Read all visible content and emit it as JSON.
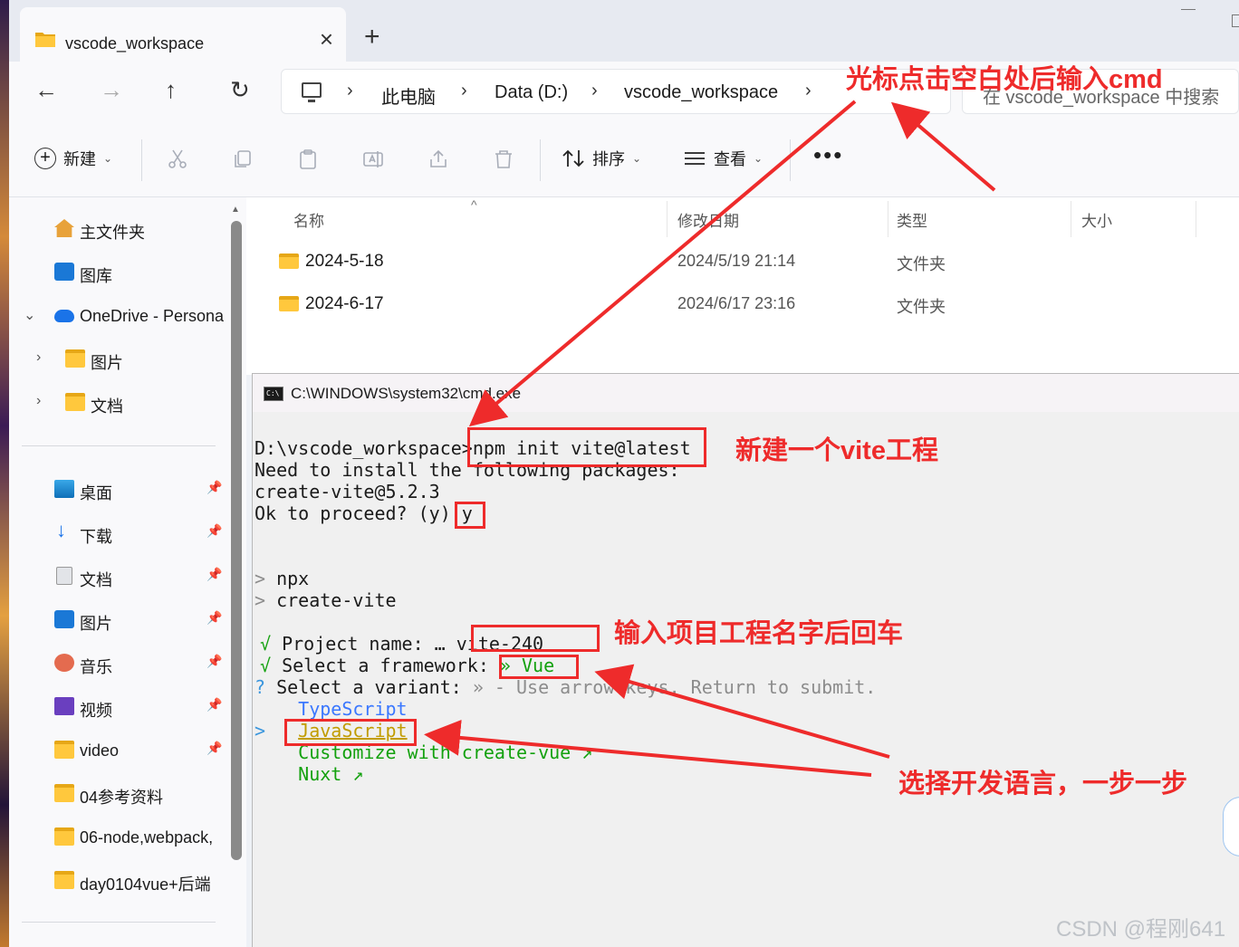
{
  "window": {
    "tab_title": "vscode_workspace",
    "close_glyph": "×",
    "new_tab_glyph": "+"
  },
  "nav": {
    "back": "←",
    "forward": "→",
    "up": "↑",
    "refresh": "↻"
  },
  "address": {
    "breadcrumbs": [
      "此电脑",
      "Data (D:)",
      "vscode_workspace"
    ],
    "separator": "›",
    "search_placeholder": "在 vscode_workspace 中搜索"
  },
  "commandbar": {
    "new_label": "新建",
    "sort_label": "排序",
    "view_label": "查看",
    "more_label": "•••",
    "caret": "⌄",
    "icons": [
      "cut-icon",
      "copy-icon",
      "paste-icon",
      "rename-icon",
      "share-icon",
      "delete-icon"
    ]
  },
  "sidebar": {
    "top_items": [
      {
        "label": "主文件夹",
        "icon": "home-icon"
      },
      {
        "label": "图库",
        "icon": "gallery-icon"
      },
      {
        "label": "OneDrive - Personal",
        "icon": "cloud-icon"
      },
      {
        "label": "图片",
        "icon": "folder-icon"
      },
      {
        "label": "文档",
        "icon": "folder-icon"
      }
    ],
    "pinned_items": [
      {
        "label": "桌面",
        "icon": "desktop-icon"
      },
      {
        "label": "下载",
        "icon": "download-icon"
      },
      {
        "label": "文档",
        "icon": "documents-icon"
      },
      {
        "label": "图片",
        "icon": "pictures-icon"
      },
      {
        "label": "音乐",
        "icon": "music-icon"
      },
      {
        "label": "视频",
        "icon": "video-icon"
      },
      {
        "label": "video",
        "icon": "folder-icon"
      },
      {
        "label": "04参考资料",
        "icon": "folder-icon"
      },
      {
        "label": "06-node,webpack,",
        "icon": "folder-icon"
      },
      {
        "label": "day0104vue+后端",
        "icon": "folder-icon"
      }
    ],
    "expand_glyph": "⌄",
    "collapse_glyph": "›",
    "pin_glyph": "📌"
  },
  "file_list": {
    "columns": [
      "名称",
      "修改日期",
      "类型",
      "大小"
    ],
    "sort_glyph": "^",
    "rows": [
      {
        "name": "2024-5-18",
        "date": "2024/5/19 21:14",
        "type": "文件夹"
      },
      {
        "name": "2024-6-17",
        "date": "2024/6/17 23:16",
        "type": "文件夹"
      }
    ]
  },
  "cmd": {
    "title": "C:\\WINDOWS\\system32\\cmd.exe",
    "icon_text": "C:\\",
    "lines": {
      "prompt": "D:\\vscode_workspace>npm init vite@latest",
      "need": "Need to install the following packages:",
      "pkg": "create-vite@5.2.3",
      "proceed_prefix": "Ok to proceed? (y) ",
      "proceed_answer": "y",
      "npx_arrow": ">",
      "npx": " npx",
      "create_arrow": ">",
      "create": " create-vite",
      "check": "√",
      "project_label": " Project name: … ",
      "project_value": "vite-240",
      "framework_label": " Select a framework: ",
      "framework_value": "» Vue",
      "q": "?",
      "variant_label": " Select a variant: ",
      "variant_hint": "» - Use arrow-keys. Return to submit.",
      "opt_ts": "    TypeScript",
      "cursor": ">",
      "opt_js": "JavaScript",
      "opt_custom": "    Customize with create-vue ↗",
      "opt_nuxt": "    Nuxt ↗"
    }
  },
  "annotations": {
    "a1": "光标点击空白处后输入cmd",
    "a2": "新建一个vite工程",
    "a3": "输入项目工程名字后回车",
    "a4": "选择开发语言，一步一步"
  },
  "watermark": "CSDN @程刚641",
  "colors": {
    "annotation_red": "#ee2b2b",
    "terminal_green": "#13a10e",
    "terminal_yellow": "#c19c00"
  }
}
